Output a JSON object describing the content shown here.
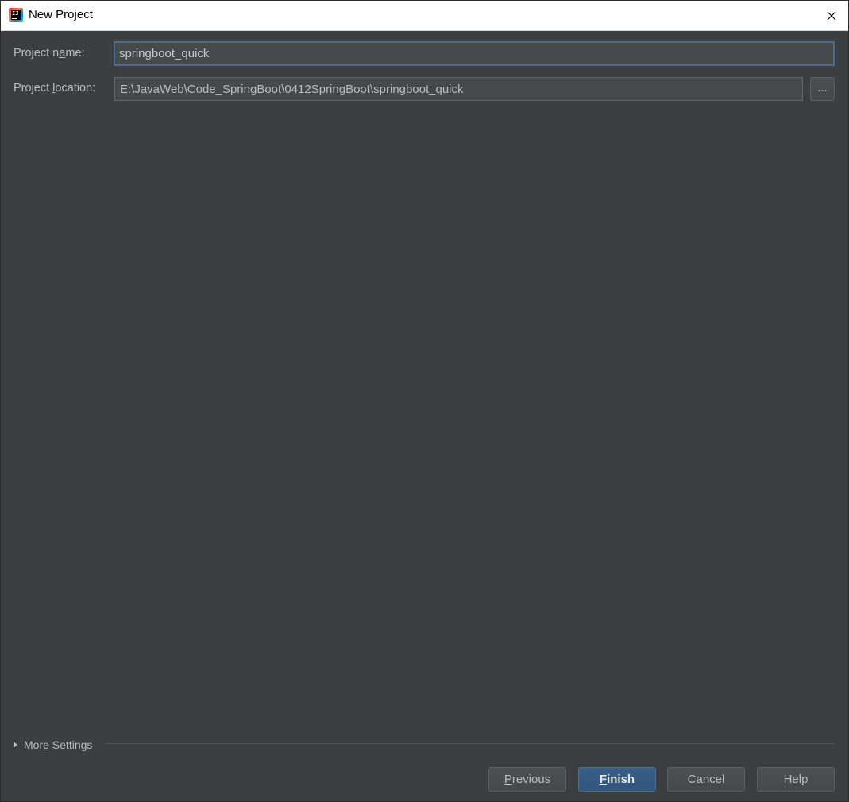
{
  "window": {
    "title": "New Project",
    "close_icon": "close-icon",
    "app_icon": "intellij-idea-icon",
    "app_icon_text": "IJ"
  },
  "form": {
    "project_name": {
      "label_pre": "Project n",
      "label_mn": "a",
      "label_post": "me:",
      "value": "springboot_quick"
    },
    "project_location": {
      "label_pre": "Project ",
      "label_mn": "l",
      "label_post": "ocation:",
      "value": "E:\\JavaWeb\\Code_SpringBoot\\0412SpringBoot\\springboot_quick",
      "browse_label": "..."
    }
  },
  "more_settings": {
    "label_pre": "Mor",
    "label_mn": "e",
    "label_post": " Settings"
  },
  "buttons": {
    "previous": {
      "mn": "P",
      "rest": "revious"
    },
    "finish": {
      "mn": "F",
      "rest": "inish"
    },
    "cancel": "Cancel",
    "help": "Help"
  },
  "colors": {
    "background": "#3c3f41",
    "field_background": "#45494a",
    "focus_border": "#466d94",
    "primary_button": "#365880",
    "text": "#bbbbbb"
  }
}
